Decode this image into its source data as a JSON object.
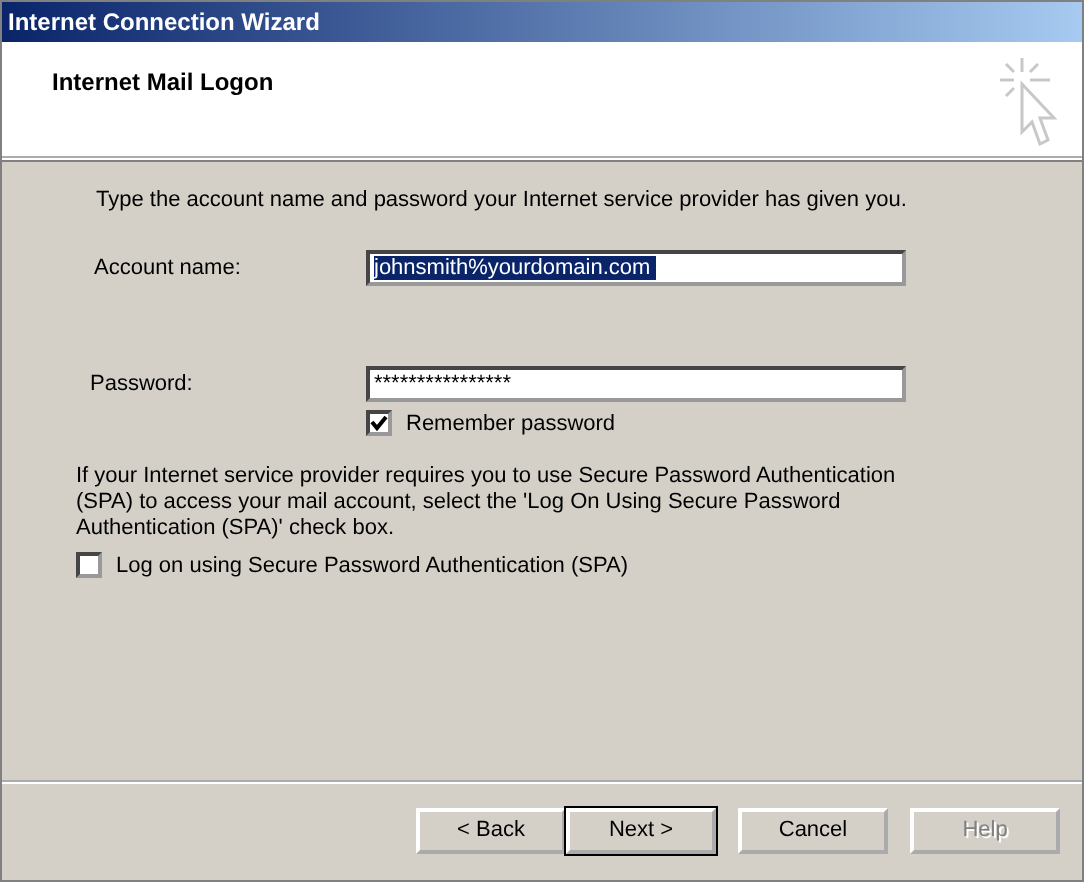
{
  "window": {
    "title": "Internet Connection Wizard"
  },
  "header": {
    "title": "Internet Mail Logon"
  },
  "intro": "Type the account name and password your Internet service provider has given you.",
  "fields": [
    {
      "label": "Account name:",
      "value": "johnsmith%yourdomain.com",
      "selected": true
    },
    {
      "label": "Password:",
      "value": "****************",
      "selected": false
    }
  ],
  "remember": {
    "label": "Remember password",
    "checked": true
  },
  "spa_note": "If your Internet service provider requires you to use Secure Password Authentication (SPA) to access your mail account, select the 'Log On Using Secure Password Authentication (SPA)' check box.",
  "spa": {
    "label": "Log on using Secure Password Authentication (SPA)",
    "checked": false
  },
  "buttons": [
    {
      "label": "< Back",
      "default": false,
      "disabled": false
    },
    {
      "label": "Next >",
      "default": true,
      "disabled": false
    },
    {
      "label": "Cancel",
      "default": false,
      "disabled": false
    },
    {
      "label": "Help",
      "default": false,
      "disabled": true
    }
  ]
}
